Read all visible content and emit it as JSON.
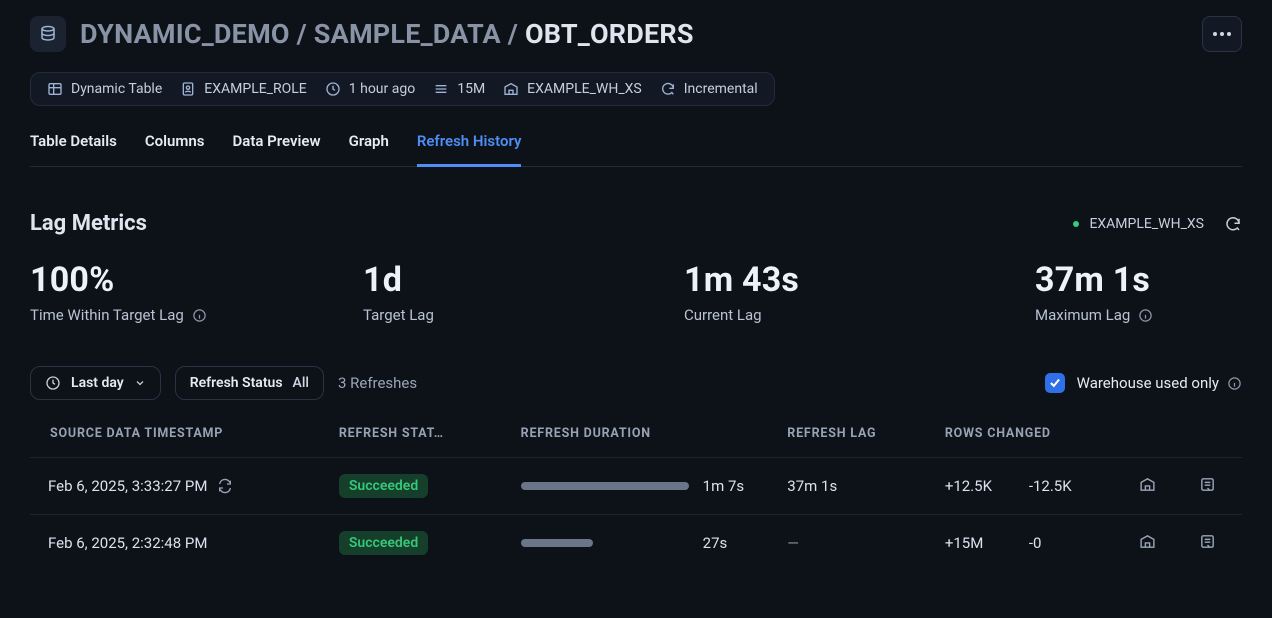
{
  "breadcrumb": {
    "p1": "DYNAMIC_DEMO",
    "p2": "SAMPLE_DATA",
    "p3": "OBT_ORDERS"
  },
  "meta": {
    "type": "Dynamic Table",
    "role": "EXAMPLE_ROLE",
    "since": "1 hour ago",
    "rows": "15M",
    "warehouse": "EXAMPLE_WH_XS",
    "mode": "Incremental"
  },
  "tabs": {
    "details": "Table Details",
    "columns": "Columns",
    "preview": "Data Preview",
    "graph": "Graph",
    "history": "Refresh History"
  },
  "section_title": "Lag Metrics",
  "wh_label": "EXAMPLE_WH_XS",
  "metrics": {
    "within": {
      "value": "100%",
      "label": "Time Within Target Lag"
    },
    "target": {
      "value": "1d",
      "label": "Target Lag"
    },
    "current": {
      "value": "1m 43s",
      "label": "Current Lag"
    },
    "max": {
      "value": "37m 1s",
      "label": "Maximum Lag"
    }
  },
  "filters": {
    "range": "Last day",
    "status_label": "Refresh Status",
    "status_value": "All",
    "count": "3 Refreshes",
    "wh_only": "Warehouse used only"
  },
  "columns": {
    "ts": "SOURCE DATA TIMESTAMP",
    "status": "REFRESH STAT…",
    "duration": "REFRESH DURATION",
    "lag": "REFRESH LAG",
    "rows": "ROWS CHANGED"
  },
  "rows": [
    {
      "ts": "Feb 6, 2025, 3:33:27 PM",
      "status": "Succeeded",
      "duration": "1m 7s",
      "bar_pct": 100,
      "lag": "37m 1s",
      "rows_add": "+12.5K",
      "rows_del": "-12.5K",
      "show_sync": true
    },
    {
      "ts": "Feb 6, 2025, 2:32:48 PM",
      "status": "Succeeded",
      "duration": "27s",
      "bar_pct": 43,
      "lag": "—",
      "rows_add": "+15M",
      "rows_del": "-0",
      "show_sync": false
    }
  ]
}
